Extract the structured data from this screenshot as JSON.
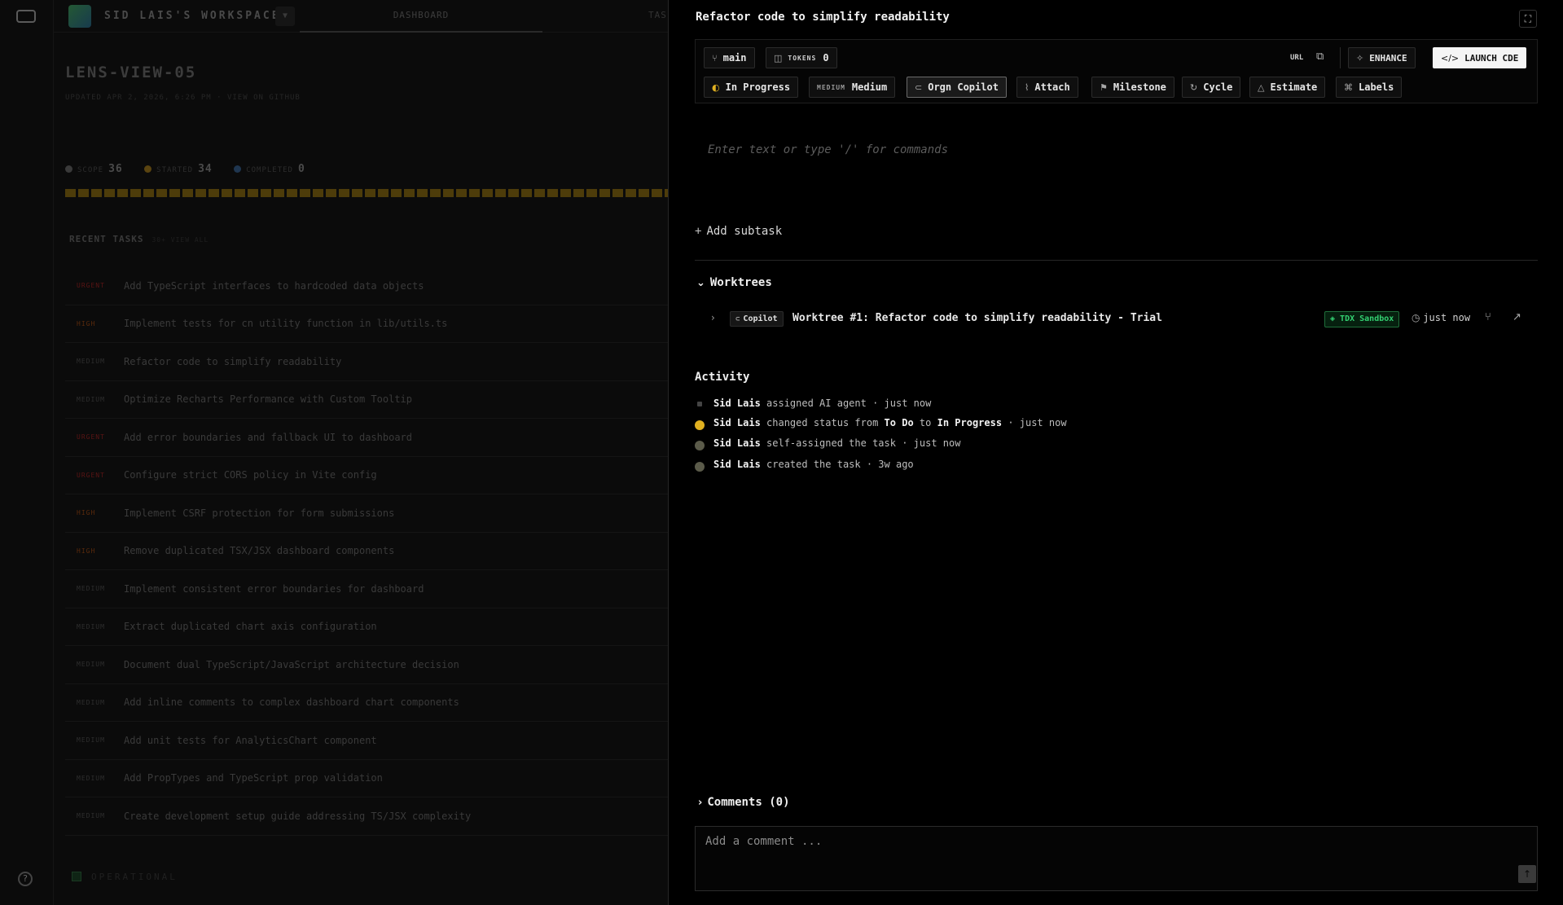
{
  "workspace": {
    "name": "SID LAIS'S WORKSPACE",
    "tab_dashboard": "DASHBOARD",
    "tab_tasks": "TAS"
  },
  "project": {
    "title": "LENS-VIEW-05",
    "meta": "UPDATED APR 2, 2026, 6:26 PM · VIEW ON GITHUB",
    "stats": [
      {
        "label": "SCOPE",
        "value": "36",
        "color": "#3a3a3a"
      },
      {
        "label": "STARTED",
        "value": "34",
        "color": "#5a4410"
      },
      {
        "label": "COMPLETED",
        "value": "0",
        "color": "#1f3650"
      }
    ],
    "recent_title": "RECENT TASKS",
    "recent_sub": "30+ VIEW ALL",
    "tasks": [
      {
        "priority": "URGENT",
        "title": "Add TypeScript interfaces to hardcoded data objects"
      },
      {
        "priority": "HIGH",
        "title": "Implement tests for cn utility function in lib/utils.ts"
      },
      {
        "priority": "MEDIUM",
        "title": "Refactor code to simplify readability"
      },
      {
        "priority": "MEDIUM",
        "title": "Optimize Recharts Performance with Custom Tooltip"
      },
      {
        "priority": "URGENT",
        "title": "Add error boundaries and fallback UI to dashboard"
      },
      {
        "priority": "URGENT",
        "title": "Configure strict CORS policy in Vite config"
      },
      {
        "priority": "HIGH",
        "title": "Implement CSRF protection for form submissions"
      },
      {
        "priority": "HIGH",
        "title": "Remove duplicated TSX/JSX dashboard components"
      },
      {
        "priority": "MEDIUM",
        "title": "Implement consistent error boundaries for dashboard"
      },
      {
        "priority": "MEDIUM",
        "title": "Extract duplicated chart axis configuration"
      },
      {
        "priority": "MEDIUM",
        "title": "Document dual TypeScript/JavaScript architecture decision"
      },
      {
        "priority": "MEDIUM",
        "title": "Add inline comments to complex dashboard chart components"
      },
      {
        "priority": "MEDIUM",
        "title": "Add unit tests for AnalyticsChart component"
      },
      {
        "priority": "MEDIUM",
        "title": "Add PropTypes and TypeScript prop validation"
      },
      {
        "priority": "MEDIUM",
        "title": "Create development setup guide addressing TS/JSX complexity"
      }
    ],
    "priority_colors": {
      "URGENT": "#5a1414",
      "HIGH": "#5a2a0c",
      "MEDIUM": "#2e2e2e"
    },
    "status": "OPERATIONAL"
  },
  "panel": {
    "title": "Refactor code to simplify readability",
    "branch": "main",
    "tokens_label": "TOKENS",
    "tokens_value": "0",
    "url_label": "URL",
    "enhance": "ENHANCE",
    "launch": "LAUNCH CDE",
    "props": {
      "status": "In Progress",
      "priority_tag": "MEDIUM",
      "priority": "Medium",
      "assignee": "Orgn Copilot",
      "attach": "Attach",
      "milestone": "Milestone",
      "cycle": "Cycle",
      "estimate": "Estimate",
      "labels": "Labels"
    },
    "editor_placeholder": "Enter text or type '/' for commands",
    "add_subtask": "Add subtask",
    "worktrees_title": "Worktrees",
    "worktree": {
      "agent": "Copilot",
      "title": "Worktree #1: Refactor code to simplify readability - Trial",
      "sandbox": "TDX Sandbox",
      "time": "just now"
    },
    "activity_title": "Activity",
    "activity": [
      {
        "user": "Sid Lais",
        "a": "assigned AI agent · just now",
        "b": "",
        "c": "",
        "d": "",
        "e": ""
      },
      {
        "user": "Sid Lais",
        "a": "changed status from",
        "b": "To Do",
        "c": "to",
        "d": "In Progress",
        "e": "· just now"
      },
      {
        "user": "Sid Lais",
        "a": "self-assigned the task · just now",
        "b": "",
        "c": "",
        "d": "",
        "e": ""
      },
      {
        "user": "Sid Lais",
        "a": "created the task · 3w ago",
        "b": "",
        "c": "",
        "d": "",
        "e": ""
      }
    ],
    "comments_title": "Comments (0)",
    "comment_placeholder": "Add a comment ..."
  }
}
